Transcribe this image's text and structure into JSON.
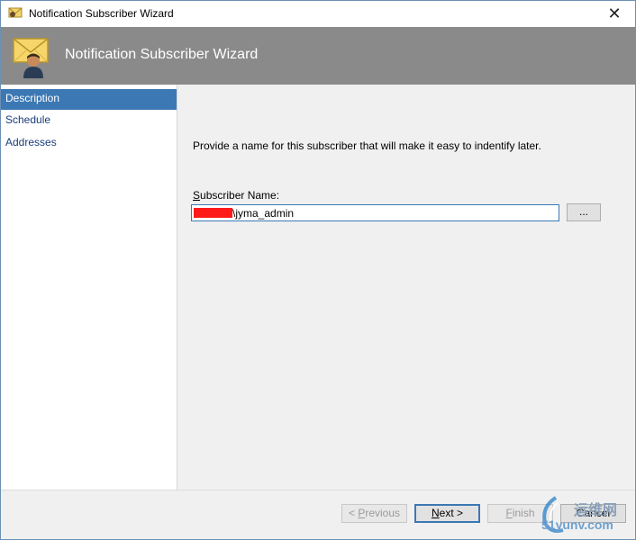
{
  "window": {
    "title": "Notification Subscriber Wizard",
    "close_glyph": "✕"
  },
  "banner": {
    "title": "Notification Subscriber Wizard",
    "icon": "envelope-user-icon",
    "background": "#8a8a8a"
  },
  "sidebar": {
    "items": [
      {
        "label": "Description",
        "selected": true
      },
      {
        "label": "Schedule",
        "selected": false
      },
      {
        "label": "Addresses",
        "selected": false
      }
    ],
    "selected_color": "#3c78b4"
  },
  "main": {
    "instruction": "Provide a name for this subscriber that will make it easy to indentify later.",
    "subscriber_label_prefix": "S",
    "subscriber_label_rest": "ubscriber Name:",
    "subscriber_value": "\\jyma_admin",
    "browse_label": "..."
  },
  "footer": {
    "previous": {
      "prefix": "< ",
      "mnemonic": "P",
      "rest": "revious",
      "enabled": false
    },
    "next": {
      "mnemonic": "N",
      "rest": "ext >",
      "enabled": true
    },
    "finish": {
      "mnemonic": "F",
      "rest": "inish",
      "enabled": false
    },
    "cancel": {
      "label": "Cancel",
      "enabled": true
    }
  },
  "watermark": {
    "line1": "运维网",
    "line2": "51yunv.com"
  }
}
